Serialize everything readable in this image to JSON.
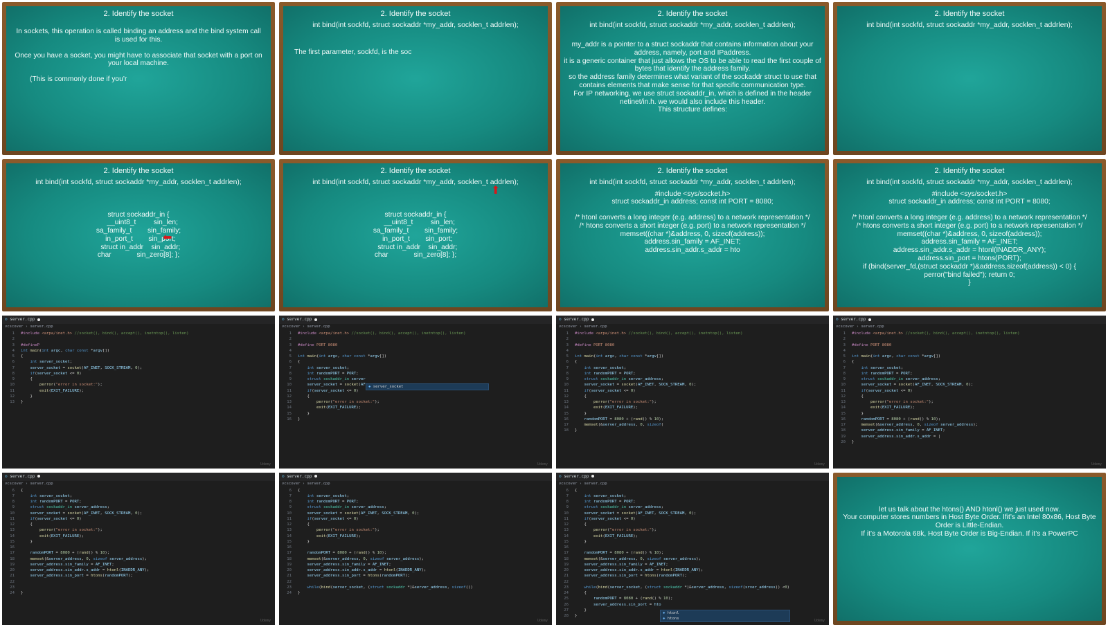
{
  "boards": [
    {
      "title": "2. Identify the socket",
      "lines": [],
      "para": [
        "In sockets, this operation is called binding an address and the bind system call is used for this.",
        "",
        "Once you have a socket, you might have to associate that socket with a port on your local machine.",
        "",
        "(This is commonly done if you’r"
      ]
    },
    {
      "title": "2. Identify the socket",
      "sig": "int bind(int sockfd, struct sockaddr *my_addr, socklen_t  addrlen);",
      "para": [
        "",
        "",
        "The first parameter, sockfd, is the soc"
      ]
    },
    {
      "title": "2. Identify the socket",
      "sig": "int bind(int sockfd, struct sockaddr *my_addr, socklen_t  addrlen);",
      "para": [
        "",
        "my_addr is a pointer to a struct sockaddr that contains information about your address, namely, port and IPaddress.",
        "it is a generic container that just allows the OS to be able to read the first couple of bytes that identify the address family.",
        "so the address family determines what variant of the sockaddr struct to use that contains elements that make sense for that specific communication type.",
        "For IP networking, we use struct sockaddr_in, which is defined in the header netinet/in.h.  we would also include this header.",
        "This structure defines:"
      ]
    },
    {
      "title": "2. Identify the socket",
      "sig": "int bind(int sockfd, struct sockaddr *my_addr, socklen_t  addrlen);",
      "para": []
    },
    {
      "title": "2. Identify the socket",
      "sig": "int bind(int sockfd, struct sockaddr *my_addr, socklen_t  addrlen);",
      "struct": [
        "struct sockaddr_in {",
        "    __uint8_t         sin_len;",
        "sa_family_t        sin_family;",
        "  in_port_t        sin_port;",
        "  struct in_addr    sin_addr;",
        "char             sin_zero[8]; };"
      ]
    },
    {
      "title": "2. Identify the socket",
      "sig": "int bind(int sockfd, struct sockaddr *my_addr, socklen_t  addrlen);",
      "struct": [
        "struct sockaddr_in {",
        "    __uint8_t         sin_len;",
        "sa_family_t        sin_family;",
        "  in_port_t        sin_port;",
        "  struct in_addr    sin_addr;",
        "char             sin_zero[8]; };"
      ]
    },
    {
      "title": "2. Identify the socket",
      "sig": "int bind(int sockfd, struct sockaddr *my_addr, socklen_t  addrlen);",
      "para": [
        "#include <sys/socket.h>",
        "struct sockaddr_in address; const int PORT = 8080;",
        "",
        "/* htonl converts a long integer (e.g. address) to a network representation */",
        "/* htons converts a short integer (e.g. port) to a network representation */",
        "memset((char *)&address, 0, sizeof(address));",
        "address.sin_family = AF_INET;",
        "address.sin_addr.s_addr = hto"
      ]
    },
    {
      "title": "2. Identify the socket",
      "sig": "int bind(int sockfd, struct sockaddr *my_addr, socklen_t  addrlen);",
      "para": [
        "#include <sys/socket.h>",
        "struct sockaddr_in address; const int PORT = 8080;",
        "",
        "/* htonl converts a long integer (e.g. address) to a network representation */",
        "/* htons converts a short integer (e.g. port) to a network representation */",
        "memset((char *)&address, 0, sizeof(address));",
        "address.sin_family = AF_INET;",
        "address.sin_addr.s_addr = htonl(INADDR_ANY);",
        "address.sin_port = htons(PORT);",
        "if (bind(server_fd,(struct sockaddr *)&address,sizeof(address)) < 0) {",
        "perror(\"bind failed\");      return 0;",
        "}"
      ]
    },
    {
      "title": "",
      "sig": "",
      "para": [
        "let us talk about the htons() AND htonl() we just used now.",
        "Your computer stores numbers in Host Byte Order. Ifit’s an  Intel 80x86, Host Byte Order is Little-Endian.",
        "If it’s a Motorola 68k, Host Byte Order is Big-Endian. If it’s a PowerPC"
      ]
    }
  ],
  "editor": {
    "tab_name": "server.cpp",
    "crumb_folder": "vcscover",
    "crumb_file": "server.cpp",
    "watermark": "Udemy",
    "frames": [
      {
        "lines": [
          [
            "1",
            "#include <arpa/inet.h> //socket(), bind(), accept(), inetntop(), listen)"
          ],
          [
            "2",
            ""
          ],
          [
            "3",
            "#defineP"
          ],
          [
            "4",
            "int main(int argc, char const *argv[])"
          ],
          [
            "5",
            "{"
          ],
          [
            "6",
            "    int server_socket;"
          ],
          [
            "7",
            "    server_socket = socket(AF_INET, SOCK_STREAM, 0);"
          ],
          [
            "8",
            "    if(server_socket <= 0)"
          ],
          [
            "9",
            "    {"
          ],
          [
            "10",
            "        perror(\"error in socket:\");"
          ],
          [
            "11",
            "        exit(EXIT_FAILURE);"
          ],
          [
            "12",
            "    }"
          ],
          [
            "13",
            "}"
          ]
        ]
      },
      {
        "lines": [
          [
            "1",
            "#include <arpa/inet.h> //socket(), bind(), accept(), inetntop(), listen)"
          ],
          [
            "2",
            ""
          ],
          [
            "3",
            "#define PORT 8080"
          ],
          [
            "4",
            ""
          ],
          [
            "5",
            "int main(int argc, char const *argv[])"
          ],
          [
            "6",
            "{"
          ],
          [
            "7",
            "    int server_socket;"
          ],
          [
            "8",
            "    int randomPORT = PORT;"
          ],
          [
            "9",
            "    struct sockaddr_in server"
          ],
          [
            "10",
            "    server_socket = socket(AF"
          ],
          [
            "11",
            "    if(server_socket <= 0)"
          ],
          [
            "12",
            "    {"
          ],
          [
            "13",
            "        perror(\"error in socket:\");"
          ],
          [
            "14",
            "        exit(EXIT_FAILURE);"
          ],
          [
            "15",
            "    }"
          ],
          [
            "16",
            "}"
          ]
        ],
        "suggest": [
          "server_socket"
        ]
      },
      {
        "lines": [
          [
            "1",
            "#include <arpa/inet.h> //socket(), bind(), accept(), inetntop(), listen)"
          ],
          [
            "2",
            ""
          ],
          [
            "3",
            "#define PORT 8080"
          ],
          [
            "4",
            ""
          ],
          [
            "5",
            "int main(int argc, char const *argv[])"
          ],
          [
            "6",
            "{"
          ],
          [
            "7",
            "    int server_socket;"
          ],
          [
            "8",
            "    int randomPORT = PORT;"
          ],
          [
            "9",
            "    struct sockaddr_in server_address;"
          ],
          [
            "10",
            "    server_socket = socket(AF_INET, SOCK_STREAM, 0);"
          ],
          [
            "11",
            "    if(server_socket <= 0)"
          ],
          [
            "12",
            "    {"
          ],
          [
            "13",
            "        perror(\"error in socket:\");"
          ],
          [
            "14",
            "        exit(EXIT_FAILURE);"
          ],
          [
            "15",
            "    }"
          ],
          [
            "16",
            "    randomPORT = 8080 + (rand() % 10);"
          ],
          [
            "17",
            "    memset(&server_address, 0, sizeof("
          ],
          [
            "18",
            "}"
          ]
        ]
      },
      {
        "lines": [
          [
            "1",
            "#include <arpa/inet.h> //socket(), bind(), accept(), inetntop(), listen)"
          ],
          [
            "2",
            ""
          ],
          [
            "3",
            "#define PORT 8080"
          ],
          [
            "4",
            ""
          ],
          [
            "5",
            "int main(int argc, char const *argv[])"
          ],
          [
            "6",
            "{"
          ],
          [
            "7",
            "    int server_socket;"
          ],
          [
            "8",
            "    int randomPORT = PORT;"
          ],
          [
            "9",
            "    struct sockaddr_in server_address;"
          ],
          [
            "10",
            "    server_socket = socket(AF_INET, SOCK_STREAM, 0);"
          ],
          [
            "11",
            "    if(server_socket <= 0)"
          ],
          [
            "12",
            "    {"
          ],
          [
            "13",
            "        perror(\"error in socket:\");"
          ],
          [
            "14",
            "        exit(EXIT_FAILURE);"
          ],
          [
            "15",
            "    }"
          ],
          [
            "16",
            "    randomPORT = 8080 + (rand() % 10);"
          ],
          [
            "17",
            "    memset(&server_address, 0, sizeof server_address);"
          ],
          [
            "18",
            "    server_address.sin_family = AF_INET;"
          ],
          [
            "19",
            "    server_address.sin_addr.s_addr = |"
          ],
          [
            "20",
            "}"
          ]
        ]
      },
      {
        "lines": [
          [
            "6",
            "{"
          ],
          [
            "7",
            "    int server_socket;"
          ],
          [
            "8",
            "    int randomPORT = PORT;"
          ],
          [
            "9",
            "    struct sockaddr_in server_address;"
          ],
          [
            "10",
            "    server_socket = socket(AF_INET, SOCK_STREAM, 0);"
          ],
          [
            "11",
            "    if(server_socket <= 0)"
          ],
          [
            "12",
            "    {"
          ],
          [
            "13",
            "        perror(\"error in socket:\");"
          ],
          [
            "14",
            "        exit(EXIT_FAILURE);"
          ],
          [
            "15",
            "    }"
          ],
          [
            "16",
            ""
          ],
          [
            "17",
            "    randomPORT = 8080 + (rand() % 10);"
          ],
          [
            "18",
            "    memset(&server_address, 0, sizeof server_address);"
          ],
          [
            "19",
            "    server_address.sin_family = AF_INET;"
          ],
          [
            "20",
            "    server_address.sin_addr.s_addr = htonl(INADDR_ANY);"
          ],
          [
            "21",
            "    server_address.sin_port = htons(randomPORT);"
          ],
          [
            "22",
            ""
          ],
          [
            "23",
            ""
          ],
          [
            "24",
            "}"
          ]
        ]
      },
      {
        "lines": [
          [
            "6",
            "{"
          ],
          [
            "7",
            "    int server_socket;"
          ],
          [
            "8",
            "    int randomPORT = PORT;"
          ],
          [
            "9",
            "    struct sockaddr_in server_address;"
          ],
          [
            "10",
            "    server_socket = socket(AF_INET, SOCK_STREAM, 0);"
          ],
          [
            "11",
            "    if(server_socket <= 0)"
          ],
          [
            "12",
            "    {"
          ],
          [
            "13",
            "        perror(\"error in socket:\");"
          ],
          [
            "14",
            "        exit(EXIT_FAILURE);"
          ],
          [
            "15",
            "    }"
          ],
          [
            "16",
            ""
          ],
          [
            "17",
            "    randomPORT = 8080 + (rand() % 10);"
          ],
          [
            "18",
            "    memset(&server_address, 0, sizeof server_address);"
          ],
          [
            "19",
            "    server_address.sin_family = AF_INET;"
          ],
          [
            "20",
            "    server_address.sin_addr.s_addr = htonl(INADDR_ANY);"
          ],
          [
            "21",
            "    server_address.sin_port = htons(randomPORT);"
          ],
          [
            "22",
            ""
          ],
          [
            "23",
            "    while(bind(server_socket, (struct sockaddr *)&server_address, sizeof())"
          ],
          [
            "24",
            "}"
          ]
        ]
      },
      {
        "lines": [
          [
            "6",
            "{"
          ],
          [
            "7",
            "    int server_socket;"
          ],
          [
            "8",
            "    int randomPORT = PORT;"
          ],
          [
            "9",
            "    struct sockaddr_in server_address;"
          ],
          [
            "10",
            "    server_socket = socket(AF_INET, SOCK_STREAM, 0);"
          ],
          [
            "11",
            "    if(server_socket <= 0)"
          ],
          [
            "12",
            "    {"
          ],
          [
            "13",
            "        perror(\"error in socket:\");"
          ],
          [
            "14",
            "        exit(EXIT_FAILURE);"
          ],
          [
            "15",
            "    }"
          ],
          [
            "16",
            ""
          ],
          [
            "17",
            "    randomPORT = 8080 + (rand() % 10);"
          ],
          [
            "18",
            "    memset(&server_address, 0, sizeof server_address);"
          ],
          [
            "19",
            "    server_address.sin_family = AF_INET;"
          ],
          [
            "20",
            "    server_address.sin_addr.s_addr = htonl(INADDR_ANY);"
          ],
          [
            "21",
            "    server_address.sin_port = htons(randomPORT);"
          ],
          [
            "22",
            ""
          ],
          [
            "23",
            "    while(bind(server_socket, (struct sockaddr *)&server_address, sizeof(srver_address)) <0)"
          ],
          [
            "24",
            "    {"
          ],
          [
            "25",
            "        randomPORT = 8080 + (rand() % 10);"
          ],
          [
            "26",
            "        server_address.sin_port = hto"
          ],
          [
            "27",
            "    }"
          ],
          [
            "28",
            "}"
          ]
        ],
        "suggest": [
          "htonl",
          "htons"
        ]
      }
    ]
  }
}
